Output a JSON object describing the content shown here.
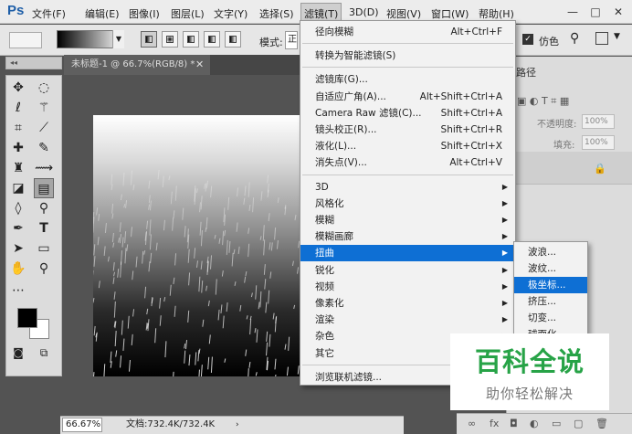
{
  "app": {
    "logo": "Ps"
  },
  "menubar": {
    "items": [
      "文件(F)",
      "编辑(E)",
      "图像(I)",
      "图层(L)",
      "文字(Y)",
      "选择(S)",
      "滤镜(T)",
      "3D(D)",
      "视图(V)",
      "窗口(W)",
      "帮助(H)"
    ],
    "active": "滤镜(T)",
    "window_controls": [
      "—",
      "□",
      "✕"
    ]
  },
  "options": {
    "mode_label": "模式:",
    "mode_value": "正",
    "dither_label": "仿色",
    "dither_checked": true
  },
  "document": {
    "tab_title": "未标题-1 @ 66.7%(RGB/8) *",
    "zoom": "66.67%",
    "doc_info": "文档:732.4K/732.4K"
  },
  "right_panel": {
    "tab_label": "路径",
    "opacity_label": "不透明度:",
    "opacity_value": "100%",
    "fill_label": "填充:",
    "fill_value": "100%"
  },
  "filter_menu": {
    "items": [
      {
        "label": "径向模糊",
        "shortcut": "Alt+Ctrl+F"
      },
      {
        "separator": true
      },
      {
        "label": "转换为智能滤镜(S)"
      },
      {
        "separator": true
      },
      {
        "label": "滤镜库(G)..."
      },
      {
        "label": "自适应广角(A)...",
        "shortcut": "Alt+Shift+Ctrl+A"
      },
      {
        "label": "Camera Raw 滤镜(C)...",
        "shortcut": "Shift+Ctrl+A"
      },
      {
        "label": "镜头校正(R)...",
        "shortcut": "Shift+Ctrl+R"
      },
      {
        "label": "液化(L)...",
        "shortcut": "Shift+Ctrl+X"
      },
      {
        "label": "消失点(V)...",
        "shortcut": "Alt+Ctrl+V"
      },
      {
        "separator": true
      },
      {
        "label": "3D",
        "submenu": true
      },
      {
        "label": "风格化",
        "submenu": true
      },
      {
        "label": "模糊",
        "submenu": true
      },
      {
        "label": "模糊画廊",
        "submenu": true
      },
      {
        "label": "扭曲",
        "submenu": true,
        "highlighted": true
      },
      {
        "label": "锐化",
        "submenu": true
      },
      {
        "label": "视频",
        "submenu": true
      },
      {
        "label": "像素化",
        "submenu": true
      },
      {
        "label": "渲染",
        "submenu": true
      },
      {
        "label": "杂色",
        "submenu": true
      },
      {
        "label": "其它",
        "submenu": true
      },
      {
        "separator": true
      },
      {
        "label": "浏览联机滤镜..."
      }
    ]
  },
  "distort_submenu": {
    "items": [
      {
        "label": "波浪..."
      },
      {
        "label": "波纹..."
      },
      {
        "label": "极坐标...",
        "highlighted": true
      },
      {
        "label": "挤压..."
      },
      {
        "label": "切变..."
      },
      {
        "label": "球面化..."
      }
    ]
  },
  "watermark": {
    "title": "百科全说",
    "subtitle": "助你轻松解决"
  },
  "colors": {
    "highlight": "#0e6fd4",
    "watermark_green": "#27a347"
  },
  "tool_icons": [
    "move-icon",
    "marquee-icon",
    "lasso-icon",
    "magic-wand-icon",
    "crop-icon",
    "eyedropper-icon",
    "healing-brush-icon",
    "brush-icon",
    "clone-stamp-icon",
    "history-brush-icon",
    "eraser-icon",
    "gradient-icon",
    "blur-icon",
    "dodge-icon",
    "pen-icon",
    "type-icon",
    "path-select-icon",
    "rectangle-icon",
    "hand-icon",
    "zoom-icon",
    "more-tools-icon"
  ]
}
